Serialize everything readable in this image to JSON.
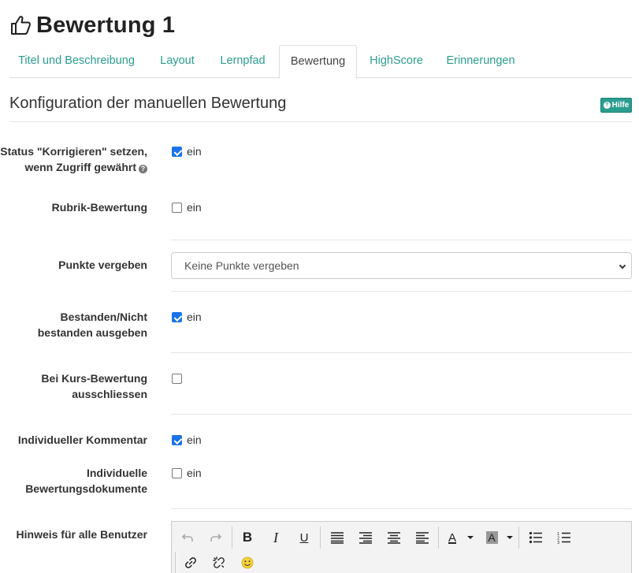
{
  "page": {
    "title": "Bewertung 1"
  },
  "tabs": [
    {
      "label": "Titel und Beschreibung"
    },
    {
      "label": "Layout"
    },
    {
      "label": "Lernpfad"
    },
    {
      "label": "Bewertung",
      "active": true
    },
    {
      "label": "HighScore"
    },
    {
      "label": "Erinnerungen"
    }
  ],
  "section": {
    "title": "Konfiguration der manuellen Bewertung",
    "help_label": "Hilfe"
  },
  "form": {
    "status_korrigieren": {
      "label_line1": "Status \"Korrigieren\" setzen,",
      "label_line2": "wenn Zugriff gewährt",
      "checked": true,
      "option": "ein"
    },
    "rubrik": {
      "label": "Rubrik-Bewertung",
      "checked": false,
      "option": "ein"
    },
    "punkte": {
      "label": "Punkte vergeben",
      "selected": "Keine Punkte vergeben"
    },
    "bestanden": {
      "label_line1": "Bestanden/Nicht",
      "label_line2": "bestanden ausgeben",
      "checked": true,
      "option": "ein"
    },
    "kurs_bewertung": {
      "label_line1": "Bei Kurs-Bewertung",
      "label_line2": "ausschliessen",
      "checked": false
    },
    "kommentar": {
      "label": "Individueller Kommentar",
      "checked": true,
      "option": "ein"
    },
    "dokumente": {
      "label_line1": "Individuelle",
      "label_line2": "Bewertungsdokumente",
      "checked": false,
      "option": "ein"
    },
    "hinweis": {
      "label": "Hinweis für alle Benutzer"
    }
  },
  "editor": {
    "bold_glyph": "B",
    "italic_glyph": "I",
    "underline_glyph": "U",
    "text_color_glyph": "A",
    "bg_color_glyph": "A"
  },
  "colors": {
    "accent": "#2a9d8f",
    "checkbox": "#1a73e8"
  }
}
